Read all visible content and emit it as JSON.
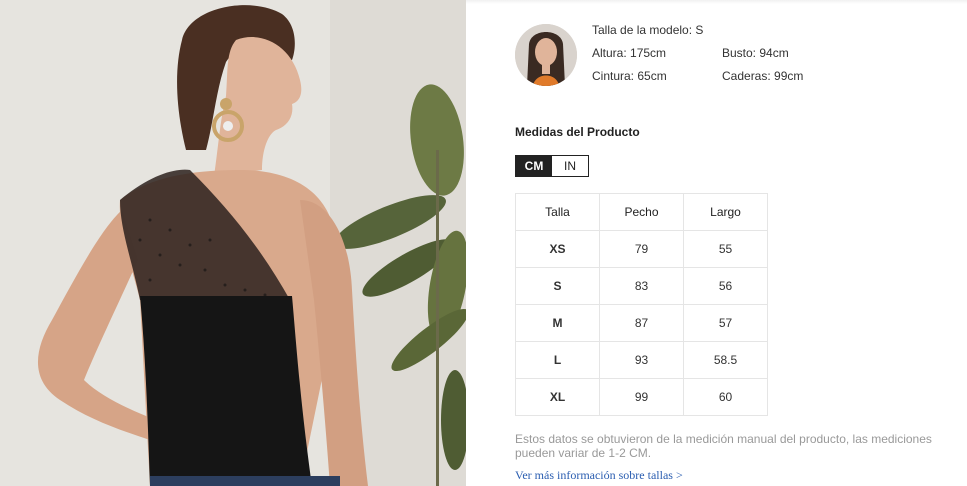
{
  "model": {
    "size_line": "Talla de la modelo: S",
    "height": "Altura: 175cm",
    "bust": "Busto: 94cm",
    "waist": "Cintura: 65cm",
    "hips": "Caderas: 99cm"
  },
  "measurements": {
    "title": "Medidas del Producto",
    "units": [
      "CM",
      "IN"
    ],
    "selected_unit": "CM",
    "headers": [
      "Talla",
      "Pecho",
      "Largo"
    ],
    "rows": [
      [
        "XS",
        "79",
        "55"
      ],
      [
        "S",
        "83",
        "56"
      ],
      [
        "M",
        "87",
        "57"
      ],
      [
        "L",
        "93",
        "58.5"
      ],
      [
        "XL",
        "99",
        "60"
      ]
    ]
  },
  "note": "Estos datos se obtuvieron de la medición manual del producto, las mediciones pueden variar de 1-2 CM.",
  "more_link": "Ver más información sobre tallas >",
  "colors": {
    "toggle_active_bg": "#222222",
    "link": "#2a5db0",
    "note_text": "#999999",
    "table_border": "#e5e5e5"
  }
}
